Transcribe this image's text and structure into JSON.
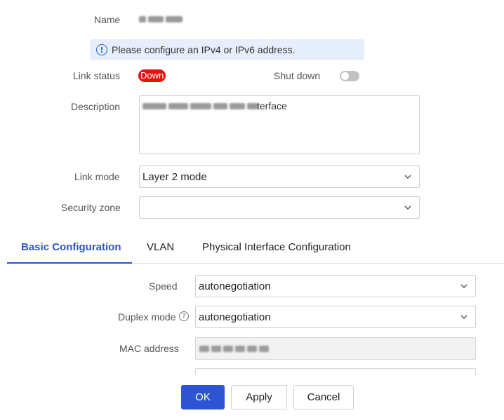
{
  "form": {
    "name_label": "Name",
    "info_message": "Please configure an IPv4 or IPv6 address.",
    "link_status_label": "Link status",
    "link_status_value": "Down",
    "shut_down_label": "Shut down",
    "shut_down_enabled": false,
    "description_label": "Description",
    "description_visible_suffix": "terface",
    "link_mode_label": "Link mode",
    "link_mode_value": "Layer 2 mode",
    "security_zone_label": "Security zone",
    "security_zone_value": ""
  },
  "tabs": [
    {
      "label": "Basic Configuration",
      "active": true
    },
    {
      "label": "VLAN",
      "active": false
    },
    {
      "label": "Physical Interface Configuration",
      "active": false
    }
  ],
  "basic": {
    "speed_label": "Speed",
    "speed_value": "autonegotiation",
    "duplex_label": "Duplex mode",
    "duplex_value": "autonegotiation",
    "mac_label": "MAC address"
  },
  "buttons": {
    "ok": "OK",
    "apply": "Apply",
    "cancel": "Cancel"
  },
  "colors": {
    "accent": "#2b55c5",
    "status_down": "#e8120c",
    "info_bg": "#e6eefb"
  }
}
